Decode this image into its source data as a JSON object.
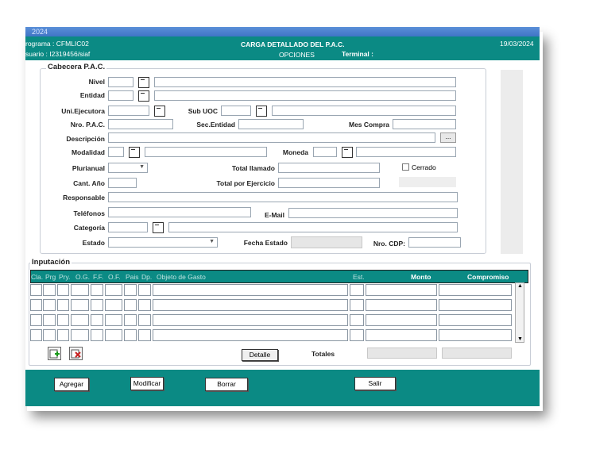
{
  "window": {
    "title": "2024"
  },
  "header": {
    "programa": "rograma : CFMLIC02",
    "usuario": "suario  : I2319456/siaf",
    "title": "CARGA DETALLADO DEL P.A.C.",
    "subtitle": "OPCIONES",
    "terminal": "Terminal :",
    "date": "19/03/2024"
  },
  "cabecera": {
    "title": "Cabecera P.A.C.",
    "labels": {
      "nivel": "Nivel",
      "entidad": "Entidad",
      "uni_ejecutora": "Uni.Ejecutora",
      "sub_uoc": "Sub UOC",
      "nro_pac": "Nro. P.A.C.",
      "sec_entidad": "Sec.Entidad",
      "mes_compra": "Mes Compra",
      "descripcion": "Descripción",
      "modalidad": "Modalidad",
      "moneda": "Moneda",
      "plurianual": "Plurianual",
      "total_llamado": "Total llamado",
      "cerrado": "Cerrado",
      "cant_anio": "Cant. Año",
      "total_ejercicio": "Total por Ejercicio",
      "responsable": "Responsable",
      "telefonos": "Teléfonos",
      "email": "E-Mail",
      "categoria": "Categoría",
      "estado": "Estado",
      "fecha_estado": "Fecha Estado",
      "nro_cdp": "Nro. CDP:"
    },
    "descripcion_button": "..."
  },
  "imputacion": {
    "title": "Inputación",
    "columns": [
      "Cla.",
      "Prg",
      "Pry.",
      "O.G.",
      "F.F.",
      "O.F.",
      "Pais",
      "Dp.",
      "Objeto de Gasto",
      "Est.",
      "Monto",
      "Compromiso"
    ],
    "detalle_button": "Detalle",
    "totales_label": "Totales"
  },
  "footer": {
    "agregar": "Agregar",
    "modificar": "Modificar",
    "borrar": "Borrar",
    "salir": "Salir"
  },
  "colors": {
    "accent": "#0b8a84",
    "titlebar": "#3f74c6"
  }
}
